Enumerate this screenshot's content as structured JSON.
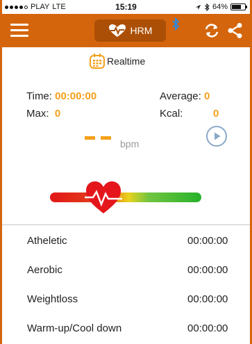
{
  "status_bar": {
    "carrier": "PLAY",
    "network": "LTE",
    "time": "15:19",
    "battery": "64%"
  },
  "navbar": {
    "hrm_label": "HRM",
    "icons": [
      "menu-icon",
      "heartbeat-icon",
      "bluetooth-icon",
      "sync-icon",
      "share-icon"
    ]
  },
  "tab": {
    "label": "Realtime",
    "icon": "calendar-grid-icon"
  },
  "stats": {
    "time_label": "Time:",
    "time_value": "00:00:00",
    "max_label": "Max:",
    "max_value": "0",
    "average_label": "Average:",
    "average_value": "0",
    "kcal_label": "Kcal:",
    "kcal_value": "0"
  },
  "heart_rate": {
    "unit": "bpm"
  },
  "zones": [
    {
      "label": "Atheletic",
      "time": "00:00:00"
    },
    {
      "label": "Aerobic",
      "time": "00:00:00"
    },
    {
      "label": "Weightloss",
      "time": "00:00:00"
    },
    {
      "label": "Warm-up/Cool down",
      "time": "00:00:00"
    }
  ],
  "colors": {
    "accent": "#d4650c",
    "value": "#f5a019",
    "heart": "#e4161c",
    "zone_red": "#e11717",
    "zone_green": "#26b12b"
  }
}
